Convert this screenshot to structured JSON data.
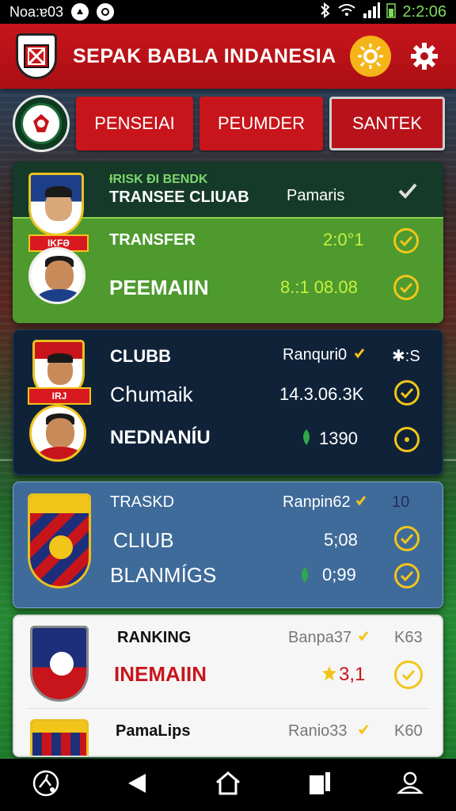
{
  "status_bar": {
    "left_text": "Nᴏa:ɐ03",
    "time": "2:2:06"
  },
  "header": {
    "title": "SEPAK BABLA INDANESIA"
  },
  "tabs": [
    {
      "label": "PENSEIAI"
    },
    {
      "label": "PEUMDER"
    },
    {
      "label": "SANTEK"
    }
  ],
  "cards": [
    {
      "header_line1": "ƗRISK ĐI BENDK",
      "header_line2": "TRANSEE CLIUAB",
      "header_right": "Pamaris",
      "rows": [
        {
          "label": "TRANSFER",
          "value": "2:0°1"
        },
        {
          "label": "PEEMAIIN",
          "value": "8.:1 08.08"
        }
      ],
      "ribbon": "IKFƏ"
    },
    {
      "rows": [
        {
          "label": "CLUBB",
          "value": "Ranquri0",
          "extra": "✱:S"
        },
        {
          "label": "Cհumaik",
          "value": "14.3.06.3K"
        },
        {
          "label": "NEDNANÍU",
          "value": "1390"
        }
      ],
      "ribbon": "IRJ"
    },
    {
      "rows": [
        {
          "label": "TRASKD",
          "value": "Ranpin62",
          "extra": "10"
        },
        {
          "label": "CLIUB",
          "value": "5;08"
        },
        {
          "label": "BLANMÍGS",
          "value": "0;99"
        }
      ]
    },
    {
      "rows": [
        {
          "label": "RANKING",
          "value": "Banpa37",
          "extra": "K63"
        },
        {
          "label": "INEMAIIN",
          "value": "3,1"
        },
        {
          "label": "PamaLips",
          "value": "Ranio33",
          "extra": "K60"
        }
      ]
    }
  ],
  "colors": {
    "header_red": "#c8151b",
    "accent_yellow": "#f2c51a",
    "green_card": "#4e9a2e",
    "navy_card": "#0f2238",
    "blue_card": "#3f6b9a"
  },
  "icons": [
    "sun-icon",
    "gear-icon",
    "check-icon",
    "ball-player-icon",
    "back-icon",
    "home-icon",
    "recents-icon",
    "account-icon"
  ]
}
